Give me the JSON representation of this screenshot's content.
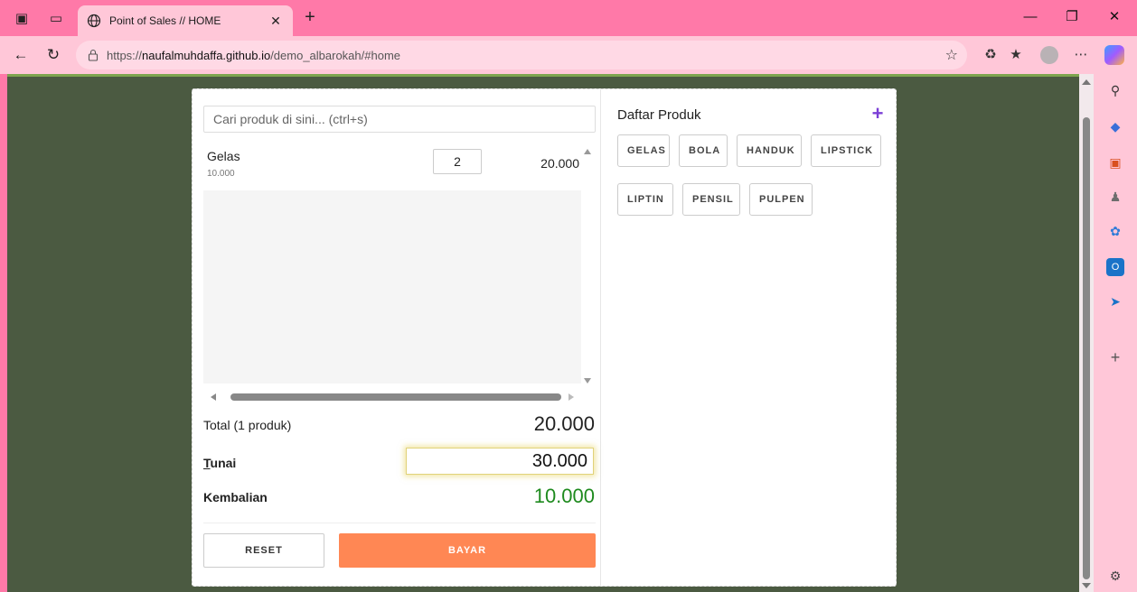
{
  "browser": {
    "tab_title": "Point of Sales // HOME",
    "url_prefix": "https://",
    "url_domain": "naufalmuhdaffa.github.io",
    "url_path": "/demo_albarokah/#home"
  },
  "pos": {
    "search_placeholder": "Cari produk di sini... (ctrl+s)",
    "cart_items": [
      {
        "name": "Gelas",
        "price": "10.000",
        "qty": "2",
        "subtotal": "20.000"
      }
    ],
    "total_label": "Total (1 produk)",
    "total_value": "20.000",
    "tunai_label": "Tunai",
    "tunai_value": "30.000",
    "kembalian_label": "Kembalian",
    "kembalian_value": "10.000",
    "reset_label": "RESET",
    "bayar_label": "BAYAR",
    "product_list_title": "Daftar Produk",
    "add_symbol": "+",
    "products": [
      "GELAS",
      "BOLA",
      "HANDUK",
      "LIPSTICK",
      "LIPTIN",
      "PENSIL",
      "PULPEN"
    ]
  },
  "colors": {
    "browser_frame": "#ff79a8",
    "page_background": "#4b5a41",
    "bayar_button": "#ff8754",
    "kembalian_text": "#1e8a1e",
    "add_icon": "#7b3fd6"
  }
}
